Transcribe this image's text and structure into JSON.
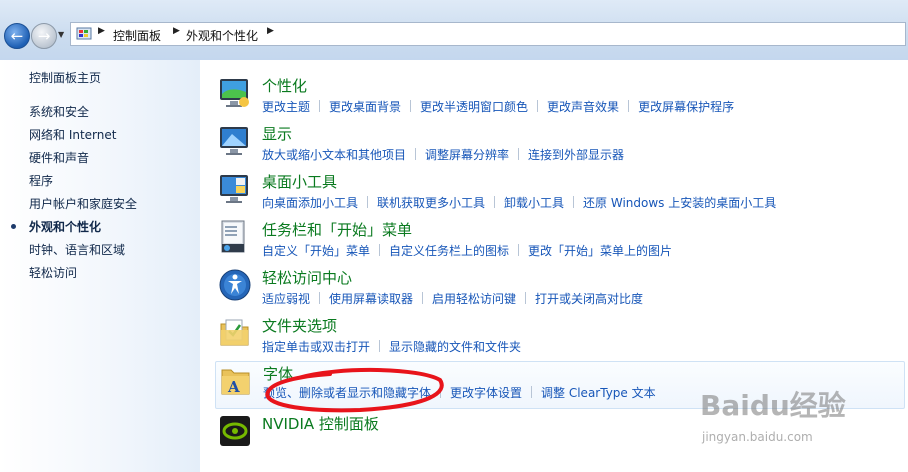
{
  "breadcrumb": [
    "控制面板",
    "外观和个性化"
  ],
  "sidebar": {
    "home": "控制面板主页",
    "items": [
      "系统和安全",
      "网络和 Internet",
      "硬件和声音",
      "程序",
      "用户帐户和家庭安全",
      "外观和个性化",
      "时钟、语言和区域",
      "轻松访问"
    ],
    "active_index": 5
  },
  "categories": [
    {
      "title": "个性化",
      "links": [
        "更改主题",
        "更改桌面背景",
        "更改半透明窗口颜色",
        "更改声音效果",
        "更改屏幕保护程序"
      ]
    },
    {
      "title": "显示",
      "links": [
        "放大或缩小文本和其他项目",
        "调整屏幕分辨率",
        "连接到外部显示器"
      ]
    },
    {
      "title": "桌面小工具",
      "links": [
        "向桌面添加小工具",
        "联机获取更多小工具",
        "卸载小工具",
        "还原 Windows 上安装的桌面小工具"
      ]
    },
    {
      "title": "任务栏和「开始」菜单",
      "links": [
        "自定义「开始」菜单",
        "自定义任务栏上的图标",
        "更改「开始」菜单上的图片"
      ]
    },
    {
      "title": "轻松访问中心",
      "links": [
        "适应弱视",
        "使用屏幕读取器",
        "启用轻松访问键",
        "打开或关闭高对比度"
      ]
    },
    {
      "title": "文件夹选项",
      "links": [
        "指定单击或双击打开",
        "显示隐藏的文件和文件夹"
      ]
    },
    {
      "title": "字体",
      "links": [
        "预览、删除或者显示和隐藏字体",
        "更改字体设置",
        "调整 ClearType 文本"
      ]
    },
    {
      "title": "NVIDIA 控制面板",
      "links": []
    }
  ],
  "watermark": {
    "brand": "Baidu经验",
    "url": "jingyan.baidu.com"
  },
  "colors": {
    "link": "#1756b8",
    "title": "#0a7a1f",
    "annotation": "#e8141b"
  }
}
